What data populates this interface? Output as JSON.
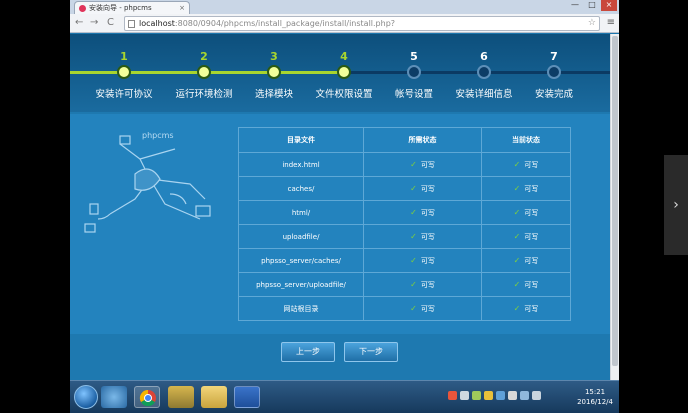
{
  "browser": {
    "tab_title": "安装向导 - phpcms",
    "tab_close": "×",
    "window_controls": [
      "—",
      "□",
      "×"
    ],
    "nav": {
      "back": "←",
      "forward": "→",
      "reload": "C"
    },
    "url_host": "localhost",
    "url_rest": ":8080/0904/phpcms/install_package/install/install.php?",
    "star": "☆",
    "menu": "≡"
  },
  "steps": [
    {
      "num": "1",
      "label": "安装许可协议",
      "state": "done"
    },
    {
      "num": "2",
      "label": "运行环境检测",
      "state": "done"
    },
    {
      "num": "3",
      "label": "选择模块",
      "state": "done"
    },
    {
      "num": "4",
      "label": "文件权限设置",
      "state": "current"
    },
    {
      "num": "5",
      "label": "帐号设置",
      "state": "todo"
    },
    {
      "num": "6",
      "label": "安装详细信息",
      "state": "todo"
    },
    {
      "num": "7",
      "label": "安装完成",
      "state": "todo"
    }
  ],
  "illustration": {
    "brand": "phpcms"
  },
  "table": {
    "headers": [
      "目录文件",
      "所需状态",
      "当前状态"
    ],
    "rows": [
      {
        "path": "index.html",
        "required": "可写",
        "current": "可写"
      },
      {
        "path": "caches/",
        "required": "可写",
        "current": "可写"
      },
      {
        "path": "html/",
        "required": "可写",
        "current": "可写"
      },
      {
        "path": "uploadfile/",
        "required": "可写",
        "current": "可写"
      },
      {
        "path": "phpsso_server/caches/",
        "required": "可写",
        "current": "可写"
      },
      {
        "path": "phpsso_server/uploadfile/",
        "required": "可写",
        "current": "可写"
      },
      {
        "path": "网站根目录",
        "required": "可写",
        "current": "可写"
      }
    ],
    "check_mark": "✓"
  },
  "buttons": {
    "prev": "上一步",
    "next": "下一步"
  },
  "taskbar": {
    "time": "15:21",
    "date": "2016/12/4"
  },
  "side_arrow": "›",
  "colors": {
    "done": "#a8d52e",
    "todo": "#0d3d66",
    "panel": "#2383be"
  }
}
